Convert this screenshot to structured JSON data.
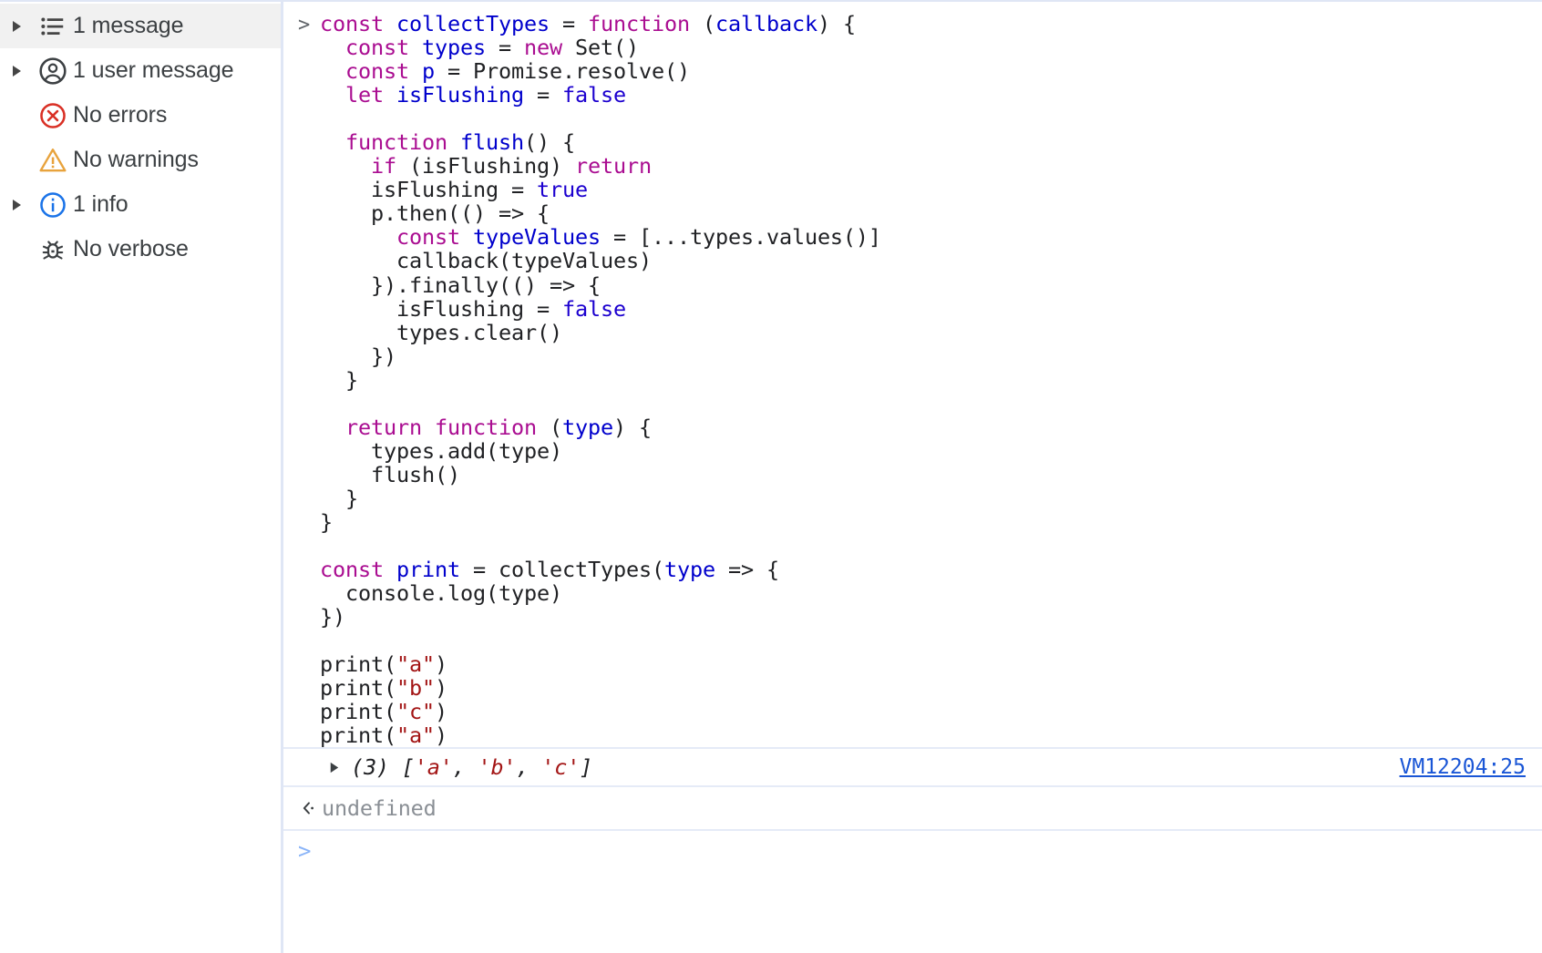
{
  "sidebar": {
    "items": [
      {
        "label": "1 message",
        "icon": "list-icon",
        "twisty": true,
        "selected": true
      },
      {
        "label": "1 user message",
        "icon": "avatar-icon",
        "twisty": true,
        "selected": false
      },
      {
        "label": "No errors",
        "icon": "error-icon",
        "twisty": false,
        "selected": false
      },
      {
        "label": "No warnings",
        "icon": "warning-icon",
        "twisty": false,
        "selected": false
      },
      {
        "label": "1 info",
        "icon": "info-icon",
        "twisty": true,
        "selected": false
      },
      {
        "label": "No verbose",
        "icon": "bug-icon",
        "twisty": false,
        "selected": false
      }
    ]
  },
  "console": {
    "input_prompt": ">",
    "code_lines": [
      [
        {
          "t": "const ",
          "c": "kw"
        },
        {
          "t": "collectTypes",
          "c": "id"
        },
        {
          "t": " = ",
          "c": "pl"
        },
        {
          "t": "function",
          "c": "kw"
        },
        {
          "t": " (",
          "c": "pl"
        },
        {
          "t": "callback",
          "c": "id"
        },
        {
          "t": ") {",
          "c": "pl"
        }
      ],
      [
        {
          "t": "  const ",
          "c": "kw"
        },
        {
          "t": "types",
          "c": "id"
        },
        {
          "t": " = ",
          "c": "pl"
        },
        {
          "t": "new",
          "c": "kw"
        },
        {
          "t": " Set()",
          "c": "pl"
        }
      ],
      [
        {
          "t": "  const ",
          "c": "kw"
        },
        {
          "t": "p",
          "c": "id"
        },
        {
          "t": " = Promise.resolve()",
          "c": "pl"
        }
      ],
      [
        {
          "t": "  let ",
          "c": "kw"
        },
        {
          "t": "isFlushing",
          "c": "id"
        },
        {
          "t": " = ",
          "c": "pl"
        },
        {
          "t": "false",
          "c": "lit"
        }
      ],
      [
        {
          "t": "",
          "c": "pl"
        }
      ],
      [
        {
          "t": "  function ",
          "c": "kw"
        },
        {
          "t": "flush",
          "c": "id"
        },
        {
          "t": "() {",
          "c": "pl"
        }
      ],
      [
        {
          "t": "    ",
          "c": "pl"
        },
        {
          "t": "if",
          "c": "kw"
        },
        {
          "t": " (isFlushing) ",
          "c": "pl"
        },
        {
          "t": "return",
          "c": "kw"
        }
      ],
      [
        {
          "t": "    isFlushing = ",
          "c": "pl"
        },
        {
          "t": "true",
          "c": "lit"
        }
      ],
      [
        {
          "t": "    p.then(() => {",
          "c": "pl"
        }
      ],
      [
        {
          "t": "      const ",
          "c": "kw"
        },
        {
          "t": "typeValues",
          "c": "id"
        },
        {
          "t": " = [...types.values()]",
          "c": "pl"
        }
      ],
      [
        {
          "t": "      callback(typeValues)",
          "c": "pl"
        }
      ],
      [
        {
          "t": "    }).finally(() => {",
          "c": "pl"
        }
      ],
      [
        {
          "t": "      isFlushing = ",
          "c": "pl"
        },
        {
          "t": "false",
          "c": "lit"
        }
      ],
      [
        {
          "t": "      types.clear()",
          "c": "pl"
        }
      ],
      [
        {
          "t": "    })",
          "c": "pl"
        }
      ],
      [
        {
          "t": "  }",
          "c": "pl"
        }
      ],
      [
        {
          "t": "",
          "c": "pl"
        }
      ],
      [
        {
          "t": "  return function ",
          "c": "kw"
        },
        {
          "t": "(",
          "c": "pl"
        },
        {
          "t": "type",
          "c": "id"
        },
        {
          "t": ") {",
          "c": "pl"
        }
      ],
      [
        {
          "t": "    types.add(type)",
          "c": "pl"
        }
      ],
      [
        {
          "t": "    flush()",
          "c": "pl"
        }
      ],
      [
        {
          "t": "  }",
          "c": "pl"
        }
      ],
      [
        {
          "t": "}",
          "c": "pl"
        }
      ],
      [
        {
          "t": "",
          "c": "pl"
        }
      ],
      [
        {
          "t": "const ",
          "c": "kw"
        },
        {
          "t": "print",
          "c": "id"
        },
        {
          "t": " = collectTypes(",
          "c": "pl"
        },
        {
          "t": "type",
          "c": "id"
        },
        {
          "t": " => {",
          "c": "pl"
        }
      ],
      [
        {
          "t": "  console.log(type)",
          "c": "pl"
        }
      ],
      [
        {
          "t": "})",
          "c": "pl"
        }
      ],
      [
        {
          "t": "",
          "c": "pl"
        }
      ],
      [
        {
          "t": "print(",
          "c": "pl"
        },
        {
          "t": "\"a\"",
          "c": "str"
        },
        {
          "t": ")",
          "c": "pl"
        }
      ],
      [
        {
          "t": "print(",
          "c": "pl"
        },
        {
          "t": "\"b\"",
          "c": "str"
        },
        {
          "t": ")",
          "c": "pl"
        }
      ],
      [
        {
          "t": "print(",
          "c": "pl"
        },
        {
          "t": "\"c\"",
          "c": "str"
        },
        {
          "t": ")",
          "c": "pl"
        }
      ],
      [
        {
          "t": "print(",
          "c": "pl"
        },
        {
          "t": "\"a\"",
          "c": "str"
        },
        {
          "t": ")",
          "c": "pl"
        }
      ]
    ],
    "result": {
      "count_label": "(3)",
      "value_parts": [
        {
          "t": " [",
          "c": "pl"
        },
        {
          "t": "'a'",
          "c": "str"
        },
        {
          "t": ", ",
          "c": "pl"
        },
        {
          "t": "'b'",
          "c": "str"
        },
        {
          "t": ", ",
          "c": "pl"
        },
        {
          "t": "'c'",
          "c": "str"
        },
        {
          "t": "]",
          "c": "pl"
        }
      ],
      "source_link": "VM12204:25"
    },
    "eval_result": "undefined",
    "prompt_placeholder": ""
  },
  "colors": {
    "keyword": "#aa0d91",
    "identifier": "#0000cc",
    "literal": "#1c00cf",
    "string": "#a31515",
    "link": "#1a56d6",
    "muted": "#8a8f95",
    "divider": "#e5ebf7",
    "selected_row": "#f1f1f1"
  }
}
